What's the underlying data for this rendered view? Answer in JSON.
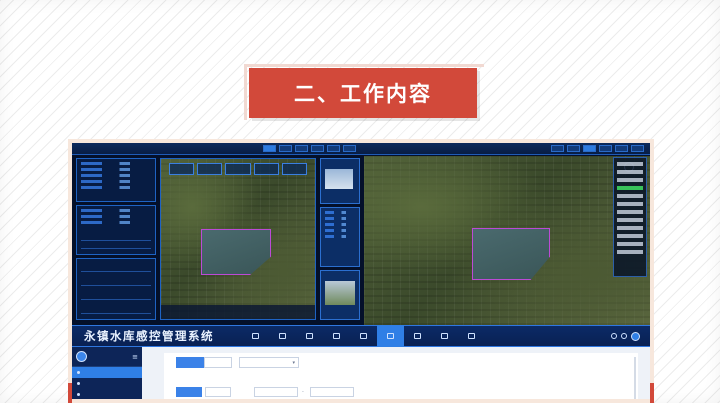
{
  "banner": {
    "title": "二、工作内容"
  },
  "colors": {
    "accent_red": "#d2493a",
    "system_blue": "#2f7fe6",
    "dark_navy": "#04102a"
  },
  "screenshot": {
    "dashboard": {
      "left_title": "",
      "right_title": "",
      "map_scale_labels": [
        "",
        "",
        "",
        ""
      ]
    },
    "system_bar": {
      "title": "永镇水库感控管理系统",
      "nav_items": [
        {
          "label": "",
          "icon": "home-icon"
        },
        {
          "label": "",
          "icon": "monitor-icon"
        },
        {
          "label": "",
          "icon": "chart-icon"
        },
        {
          "label": "",
          "icon": "water-icon"
        },
        {
          "label": "",
          "icon": "map-icon"
        },
        {
          "label": "",
          "icon": "analysis-icon"
        },
        {
          "label": "",
          "icon": "user-icon"
        },
        {
          "label": "",
          "icon": "gear-icon"
        },
        {
          "label": "",
          "icon": "file-icon"
        }
      ],
      "active_nav_index": 5,
      "user_name": ""
    },
    "sidebar": {
      "user_name": "",
      "user_role": "",
      "items": [
        {
          "label": "",
          "active": true
        },
        {
          "label": "",
          "active": false
        },
        {
          "label": "",
          "active": false
        }
      ]
    },
    "main": {
      "tabs": [
        {
          "label": ""
        },
        {
          "label": ""
        }
      ],
      "select_value": "",
      "primary_button": "",
      "secondary_button": "",
      "date_start": "",
      "date_end": ""
    }
  }
}
